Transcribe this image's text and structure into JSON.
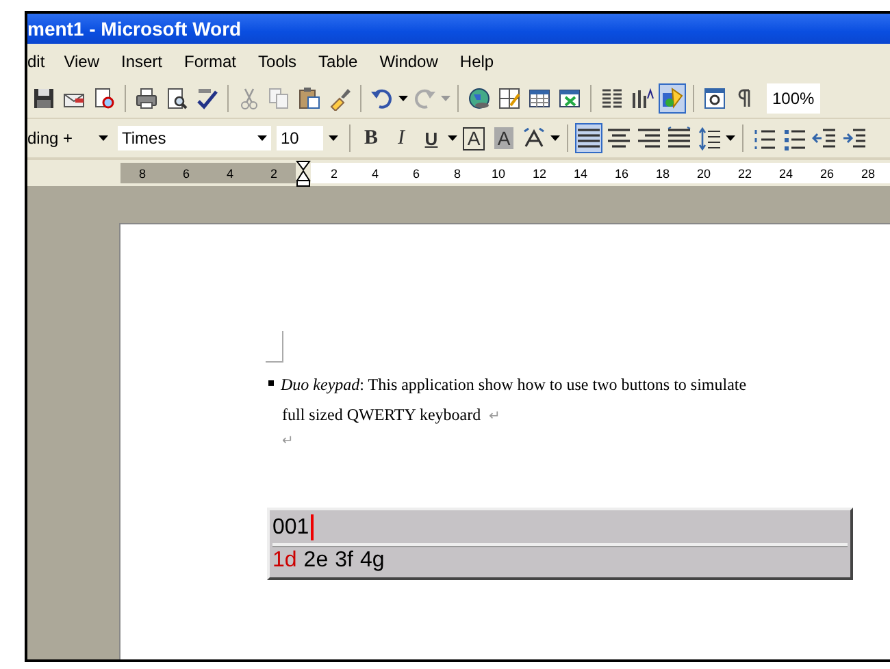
{
  "window": {
    "title": "ment1 - Microsoft Word"
  },
  "menu": [
    {
      "label": "dit"
    },
    {
      "label": "View"
    },
    {
      "label": "Insert"
    },
    {
      "label": "Format"
    },
    {
      "label": "Tools"
    },
    {
      "label": "Table"
    },
    {
      "label": "Window"
    },
    {
      "label": "Help"
    }
  ],
  "standard_toolbar": {
    "buttons": [
      {
        "pressed": false
      },
      {
        "pressed": false
      },
      {
        "pressed": false
      },
      {
        "pressed": false
      },
      {
        "pressed": false
      },
      {
        "pressed": false
      },
      {
        "pressed": false
      },
      {
        "pressed": false
      },
      {
        "pressed": false
      },
      {
        "pressed": false
      },
      {
        "pressed": false
      },
      {
        "pressed": false
      },
      {
        "pressed": false
      },
      {
        "pressed": false
      },
      {
        "pressed": false
      },
      {
        "pressed": false
      },
      {
        "pressed": false
      },
      {
        "pressed": false
      },
      {
        "pressed": true
      },
      {
        "pressed": false
      },
      {
        "pressed": false
      }
    ],
    "zoom": "100%"
  },
  "formatting_toolbar": {
    "style": "ding +",
    "font": "Times",
    "size": "10",
    "bold": "B",
    "italic": "I",
    "underline": "U",
    "border_char": "A",
    "shading_char": "A",
    "alignments": [
      {
        "selected": true
      },
      {
        "selected": false
      },
      {
        "selected": false
      },
      {
        "selected": false
      }
    ]
  },
  "ruler": {
    "left_labels": [
      "8",
      "6",
      "4",
      "2"
    ],
    "right_labels": [
      "2",
      "4",
      "6",
      "8",
      "10",
      "12",
      "14",
      "16",
      "18",
      "20",
      "22",
      "24",
      "26",
      "28"
    ]
  },
  "document": {
    "paragraph": "*Duo keypad*: This application show how to use two buttons to simulate",
    "paragraph_line_2": "full sized QWERTY keyboard",
    "paragraph_mark": "↵",
    "empty_paragraph_mark": "↵"
  },
  "keypad": {
    "input": "001",
    "candidates": [
      {
        "label": "1d",
        "selected": true
      },
      {
        "label": "2e",
        "selected": false
      },
      {
        "label": "3f",
        "selected": false
      },
      {
        "label": "4g",
        "selected": false
      }
    ]
  }
}
